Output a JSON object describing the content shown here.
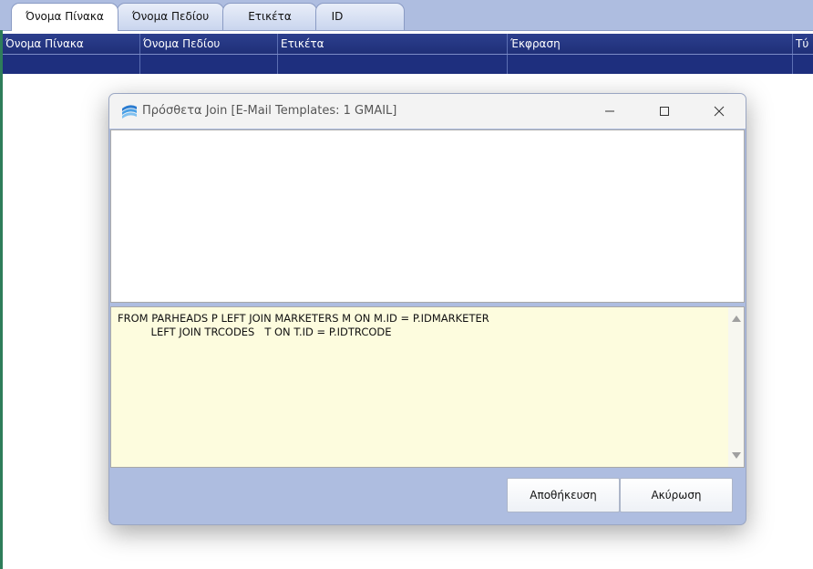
{
  "tabs": [
    {
      "label": "Όνομα Πίνακα",
      "active": true
    },
    {
      "label": "Όνομα Πεδίου",
      "active": false
    },
    {
      "label": "Ετικέτα",
      "active": false
    },
    {
      "label": "ID",
      "active": false
    }
  ],
  "grid": {
    "columns": [
      "Όνομα Πίνακα",
      "Όνομα Πεδίου",
      "Ετικέτα",
      "Έκφραση",
      "Τύ"
    ]
  },
  "dialog": {
    "title": "Πρόσθετα Join [E-Mail Templates: 1  GMAIL]",
    "sql_lines": [
      "FROM PARHEADS P LEFT JOIN MARKETERS M ON M.ID = P.IDMARKETER",
      "          LEFT JOIN TRCODES   T ON T.ID = P.IDTRCODE"
    ],
    "save_label": "Αποθήκευση",
    "cancel_label": "Ακύρωση"
  },
  "icons": {
    "app": "app-logo-icon",
    "minimize": "minimize-icon",
    "maximize": "maximize-icon",
    "close": "close-icon",
    "scroll_up": "scroll-up-arrow-icon",
    "scroll_down": "scroll-down-arrow-icon"
  },
  "colors": {
    "tabbar_bg": "#aebde0",
    "grid_header_bg": "#2c3f8d",
    "sql_bg": "#fdfcde",
    "dialog_bg": "#aebde0"
  }
}
